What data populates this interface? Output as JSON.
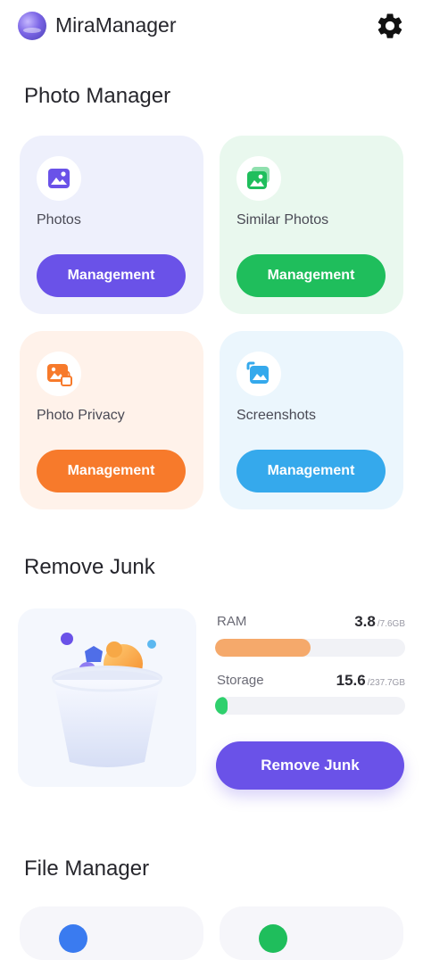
{
  "header": {
    "title": "MiraManager",
    "logo_icon": "planet-logo-icon",
    "settings_icon": "gear-icon"
  },
  "photo_manager": {
    "title": "Photo Manager",
    "cards": [
      {
        "label": "Photos",
        "button": "Management",
        "icon": "image-icon",
        "bg": "#eef0fc",
        "accent": "#6a52e8"
      },
      {
        "label": "Similar Photos",
        "button": "Management",
        "icon": "similar-images-icon",
        "bg": "#e9f8ee",
        "accent": "#1fbe5c"
      },
      {
        "label": "Photo Privacy",
        "button": "Management",
        "icon": "private-image-icon",
        "bg": "#fff2ea",
        "accent": "#f77a2b"
      },
      {
        "label": "Screenshots",
        "button": "Management",
        "icon": "screenshot-icon",
        "bg": "#ebf6fd",
        "accent": "#35a9ec"
      }
    ]
  },
  "remove_junk": {
    "title": "Remove Junk",
    "ram": {
      "label": "RAM",
      "value": "3.8",
      "total": "/7.6GB",
      "fraction": 0.5,
      "color": "#f5a96b"
    },
    "storage": {
      "label": "Storage",
      "value": "15.6",
      "total": "/237.7GB",
      "fraction": 0.066,
      "color": "#2fd06d"
    },
    "button": "Remove Junk",
    "button_color": "#6a52e8"
  },
  "file_manager": {
    "title": "File Manager",
    "cards": [
      {
        "icon": "folder-icon",
        "color": "#3a7bf0"
      },
      {
        "icon": "document-icon",
        "color": "#1fbe5c"
      }
    ]
  }
}
